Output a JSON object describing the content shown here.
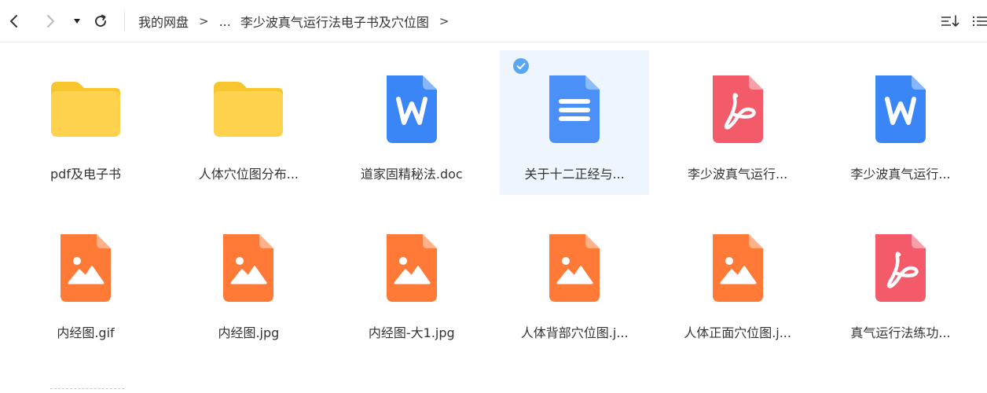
{
  "breadcrumb": {
    "root": "我的网盘",
    "separator": ">",
    "ellipsis": "...",
    "current": "李少波真气运行法电子书及穴位图",
    "trailing_separator": ">"
  },
  "toolbar": {
    "back_icon": "chevron-left-icon",
    "forward_icon": "chevron-right-icon",
    "history_icon": "caret-down-icon",
    "refresh_icon": "refresh-icon",
    "sort_icon": "sort-icon",
    "view_icon": "list-view-icon"
  },
  "colors": {
    "folder": "#ffd24d",
    "word": "#3b86f6",
    "doc": "#4a90f7",
    "pdf": "#f35a6a",
    "image": "#ff7a37",
    "selected_bg": "#eef5fd",
    "check": "#5aa6ef"
  },
  "files": [
    {
      "name": "pdf及电子书",
      "type": "folder",
      "selected": false
    },
    {
      "name": "人体穴位图分布...",
      "type": "folder",
      "selected": false
    },
    {
      "name": "道家固精秘法.doc",
      "type": "word",
      "selected": false
    },
    {
      "name": "关于十二正经与...",
      "type": "doc",
      "selected": true
    },
    {
      "name": "李少波真气运行...",
      "type": "pdf",
      "selected": false
    },
    {
      "name": "李少波真气运行...",
      "type": "word",
      "selected": false
    },
    {
      "name": "内经图.gif",
      "type": "image",
      "selected": false
    },
    {
      "name": "内经图.jpg",
      "type": "image",
      "selected": false
    },
    {
      "name": "内经图-大1.jpg",
      "type": "image",
      "selected": false
    },
    {
      "name": "人体背部穴位图.j...",
      "type": "image",
      "selected": false
    },
    {
      "name": "人体正面穴位图.j...",
      "type": "image",
      "selected": false
    },
    {
      "name": "真气运行法练功...",
      "type": "pdf",
      "selected": false
    }
  ]
}
